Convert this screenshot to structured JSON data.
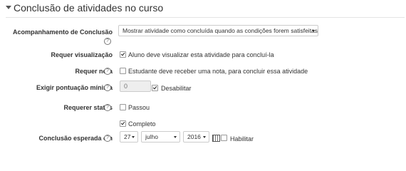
{
  "section": {
    "title": "Conclusão de atividades no curso"
  },
  "rows": {
    "tracking": {
      "label": "Acompanhamento de Conclusão",
      "value": "Mostrar atividade como concluída quando as condições forem satisfeitas"
    },
    "view": {
      "label": "Requer visualização",
      "option": "Aluno deve visualizar esta atividade para concluí-la",
      "checked": true
    },
    "grade": {
      "label": "Requer nota",
      "option": "Estudante deve receber uma nota, para concluir essa atividade",
      "checked": false
    },
    "score": {
      "label": "Exigir pontuação mínima",
      "value": "0",
      "disable_label": "Desabilitar",
      "disable_checked": true
    },
    "status": {
      "label": "Requerer status",
      "options": [
        {
          "text": "Passou",
          "checked": false
        },
        {
          "text": "Completo",
          "checked": true
        }
      ]
    },
    "expected": {
      "label": "Conclusão esperada em",
      "day": "27",
      "month": "julho",
      "year": "2016",
      "enable_label": "Habilitar",
      "enable_checked": false
    }
  },
  "icons": {
    "help": "question-circle-icon",
    "calendar": "calendar-icon",
    "collapse": "caret-down-icon"
  },
  "help_glyph": "?"
}
